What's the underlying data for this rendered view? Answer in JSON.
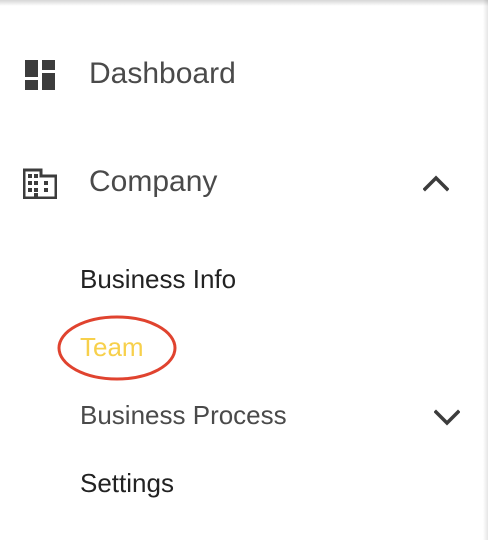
{
  "nav": {
    "dashboard": {
      "label": "Dashboard",
      "icon": "dashboard-icon"
    },
    "company": {
      "label": "Company",
      "icon": "building-icon",
      "expanded": true,
      "children": [
        {
          "label": "Business Info"
        },
        {
          "label": "Team",
          "active": true
        },
        {
          "label": "Business Process",
          "has_children": true
        },
        {
          "label": "Settings"
        }
      ]
    }
  },
  "colors": {
    "active_item": "#f7d04b",
    "label": "#4a4a4a",
    "sub_label": "#222222",
    "annotation": "#e0432f"
  }
}
